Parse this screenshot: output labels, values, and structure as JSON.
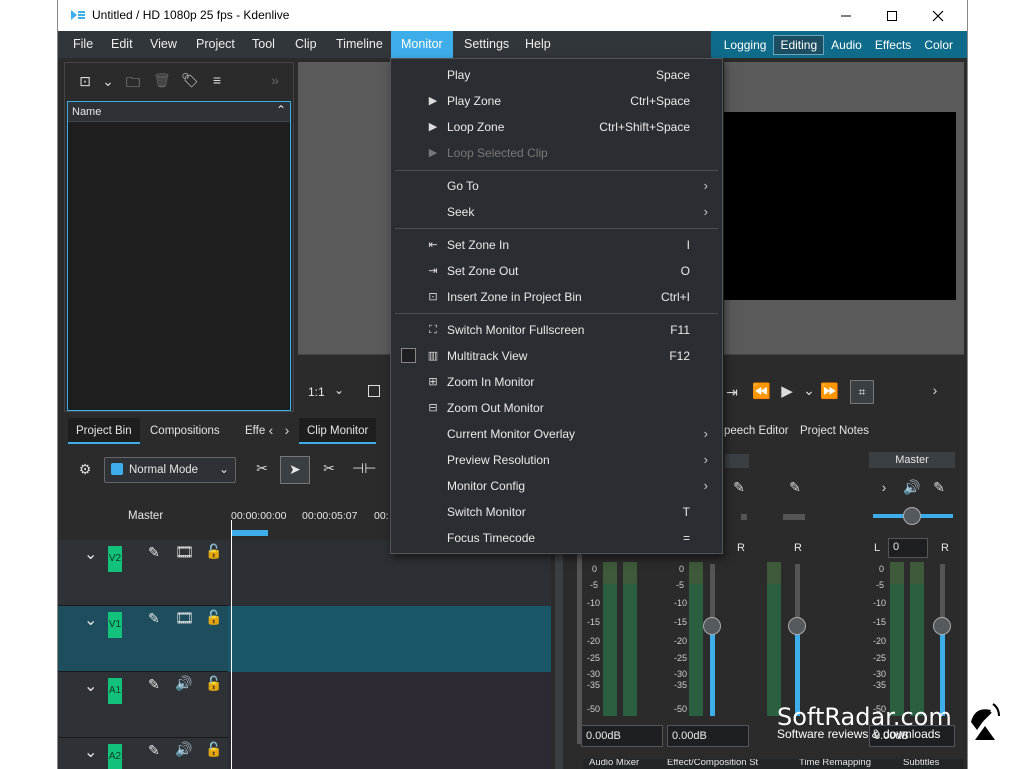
{
  "window": {
    "title": "Untitled / HD 1080p 25 fps - Kdenlive",
    "minimize_icon": "minimize-icon",
    "maximize_icon": "maximize-icon",
    "close_icon": "close-icon"
  },
  "menubar": {
    "items": [
      "File",
      "Edit",
      "View",
      "Project",
      "Tool",
      "Clip",
      "Timeline",
      "Monitor",
      "Settings",
      "Help"
    ],
    "active": "Monitor"
  },
  "layouts": {
    "items": [
      "Logging",
      "Editing",
      "Audio",
      "Effects",
      "Color"
    ],
    "active": "Editing"
  },
  "bin": {
    "column_header": "Name",
    "tabs": [
      "Project Bin",
      "Compositions",
      "Effe"
    ]
  },
  "clip_monitor": {
    "zoom": "1:1",
    "tab": "Clip Monitor"
  },
  "project_monitor": {
    "tabs": [
      "peech Editor",
      "Project Notes"
    ]
  },
  "timeline": {
    "mode": "Normal Mode",
    "master_label": "Master",
    "ruler": [
      "00:00:00:00",
      "00:00:05:07",
      "00:"
    ],
    "tracks": [
      "V2",
      "V1",
      "A1",
      "A2"
    ]
  },
  "mixer": {
    "master_label": "Master",
    "channel_left": "L",
    "channel_right": "R",
    "pan_value": "0",
    "db_scale": [
      "0",
      "-5",
      "-10",
      "-15",
      "-20",
      "-25",
      "-30",
      "-35",
      "-50"
    ],
    "db_values": [
      "0.00dB",
      "0.00dB",
      "0.00dB"
    ],
    "bottom_tabs": [
      "Audio Mixer",
      "Effect/Composition St",
      "Time Remapping",
      "Subtitles"
    ]
  },
  "monitor_menu": {
    "items": [
      {
        "label": "Play",
        "shortcut": "Space",
        "icon": "",
        "submenu": false,
        "disabled": false
      },
      {
        "label": "Play Zone",
        "shortcut": "Ctrl+Space",
        "icon": "play-icon",
        "submenu": false,
        "disabled": false
      },
      {
        "label": "Loop Zone",
        "shortcut": "Ctrl+Shift+Space",
        "icon": "play-icon",
        "submenu": false,
        "disabled": false
      },
      {
        "label": "Loop Selected Clip",
        "shortcut": "",
        "icon": "play-icon",
        "submenu": false,
        "disabled": true
      },
      {
        "label": "Go To",
        "shortcut": "",
        "icon": "",
        "submenu": true,
        "disabled": false
      },
      {
        "label": "Seek",
        "shortcut": "",
        "icon": "",
        "submenu": true,
        "disabled": false
      },
      {
        "label": "Set Zone In",
        "shortcut": "I",
        "icon": "zone-in-icon",
        "submenu": false,
        "disabled": false
      },
      {
        "label": "Set Zone Out",
        "shortcut": "O",
        "icon": "zone-out-icon",
        "submenu": false,
        "disabled": false
      },
      {
        "label": "Insert Zone in Project Bin",
        "shortcut": "Ctrl+I",
        "icon": "insert-zone-icon",
        "submenu": false,
        "disabled": false
      },
      {
        "label": "Switch Monitor Fullscreen",
        "shortcut": "F11",
        "icon": "fullscreen-icon",
        "submenu": false,
        "disabled": false
      },
      {
        "label": "Multitrack View",
        "shortcut": "F12",
        "icon": "multitrack-icon",
        "submenu": false,
        "disabled": false
      },
      {
        "label": "Zoom In Monitor",
        "shortcut": "",
        "icon": "zoom-in-icon",
        "submenu": false,
        "disabled": false
      },
      {
        "label": "Zoom Out Monitor",
        "shortcut": "",
        "icon": "zoom-out-icon",
        "submenu": false,
        "disabled": false
      },
      {
        "label": "Current Monitor Overlay",
        "shortcut": "",
        "icon": "",
        "submenu": true,
        "disabled": false
      },
      {
        "label": "Preview Resolution",
        "shortcut": "",
        "icon": "",
        "submenu": true,
        "disabled": false
      },
      {
        "label": "Monitor Config",
        "shortcut": "",
        "icon": "",
        "submenu": true,
        "disabled": false
      },
      {
        "label": "Switch Monitor",
        "shortcut": "T",
        "icon": "",
        "submenu": false,
        "disabled": false
      },
      {
        "label": "Focus Timecode",
        "shortcut": "=",
        "icon": "",
        "submenu": false,
        "disabled": false
      }
    ]
  },
  "watermark": {
    "brand": "SoftRadar.com",
    "tagline": "Software reviews & downloads"
  },
  "colors": {
    "accent": "#3daee9",
    "track_tag": "#13c27a",
    "layout_bar": "#0f6b8a"
  }
}
